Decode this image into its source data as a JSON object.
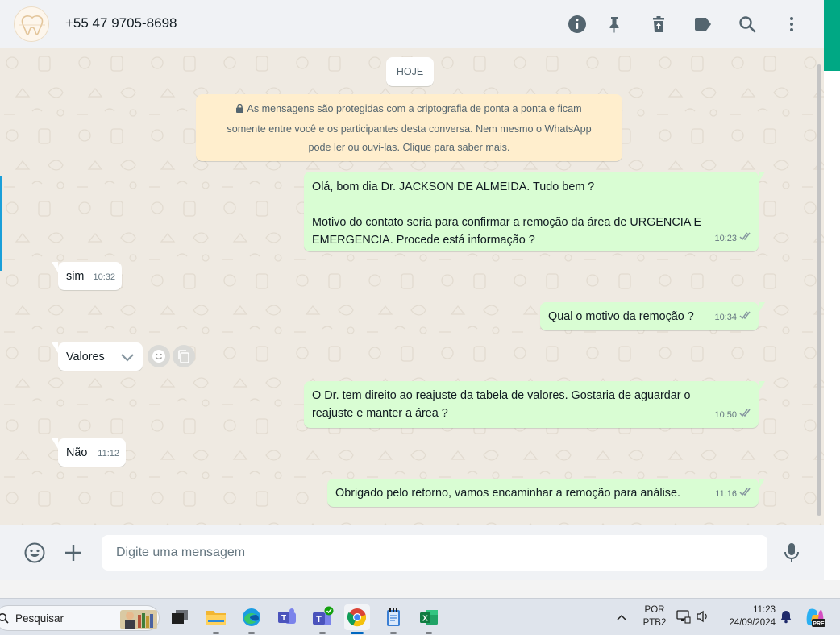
{
  "header": {
    "contact_name": "+55 47 9705-8698",
    "icons": [
      "info-icon",
      "pin-icon",
      "delete-icon",
      "label-icon",
      "search-icon",
      "menu-icon"
    ]
  },
  "chat": {
    "date_label": "HOJE",
    "encryption_notice": {
      "line1": "As mensagens são protegidas com a criptografia de ponta a ponta e ficam",
      "line2": "somente entre você e os participantes desta conversa. Nem mesmo o WhatsApp",
      "line3": "pode ler ou ouvi-las. Clique para saber mais."
    },
    "messages": [
      {
        "direction": "out",
        "text": "Olá, bom dia Dr. JACKSON DE ALMEIDA. Tudo bem ?\n\nMotivo do contato seria para confirmar a remoção da área de URGENCIA E EMERGENCIA. Procede está informação ?",
        "time": "10:23",
        "status": "read"
      },
      {
        "direction": "in",
        "text": "sim",
        "time": "10:32"
      },
      {
        "direction": "out",
        "text": "Qual o motivo da remoção ?",
        "time": "10:34",
        "status": "read"
      },
      {
        "direction": "in",
        "text": "Valores",
        "time": ""
      },
      {
        "direction": "out",
        "text": "O Dr. tem direito ao reajuste da tabela de valores. Gostaria de aguardar o reajuste e manter a área ?",
        "time": "10:50",
        "status": "read"
      },
      {
        "direction": "in",
        "text": "Não",
        "time": "11:12"
      },
      {
        "direction": "out",
        "text": "Obrigado pelo retorno, vamos encaminhar a remoção para análise.",
        "time": "11:16",
        "status": "read"
      }
    ]
  },
  "composer": {
    "placeholder": "Digite uma mensagem",
    "value": ""
  },
  "taskbar": {
    "search_label": "Pesquisar",
    "apps": [
      "widgets-icon",
      "task-view-icon",
      "file-explorer-icon",
      "edge-icon",
      "teams-icon",
      "teams-work-icon",
      "chrome-icon",
      "notepad-icon",
      "excel-icon"
    ],
    "active_app": "chrome-icon",
    "language_line1": "POR",
    "language_line2": "PTB2",
    "clock_time": "11:23",
    "clock_date": "24/09/2024",
    "copilot_badge": "PRE"
  },
  "colors": {
    "chat_bg": "#efeae2",
    "outgoing_bubble": "#d9fdd3",
    "incoming_bubble": "#ffffff",
    "header_bg": "#f0f2f5",
    "accent_green": "#00a884",
    "read_tick": "#8696a0"
  }
}
